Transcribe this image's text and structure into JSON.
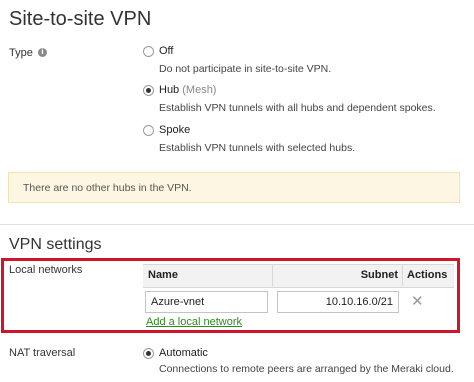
{
  "page_title": "Site-to-site VPN",
  "type": {
    "label": "Type",
    "info_icon": "i",
    "options": [
      {
        "label": "Off",
        "sublabel": "",
        "description": "Do not participate in site-to-site VPN.",
        "checked": false
      },
      {
        "label": "Hub",
        "sublabel": "(Mesh)",
        "description": "Establish VPN tunnels with all hubs and dependent spokes.",
        "checked": true
      },
      {
        "label": "Spoke",
        "sublabel": "",
        "description": "Establish VPN tunnels with selected hubs.",
        "checked": false
      }
    ]
  },
  "notice": "There are no other hubs in the VPN.",
  "vpn_settings": {
    "title": "VPN settings",
    "local_networks_label": "Local networks",
    "columns": {
      "name": "Name",
      "subnet": "Subnet",
      "actions": "Actions"
    },
    "rows": [
      {
        "name": "Azure-vnet",
        "subnet": "10.10.16.0/21"
      }
    ],
    "remove_glyph": "✕",
    "add_link": "Add a local network"
  },
  "nat_traversal": {
    "label": "NAT traversal",
    "option_label": "Automatic",
    "option_checked": true,
    "description": "Connections to remote peers are arranged by the Meraki cloud."
  },
  "colors": {
    "highlight": "#d0142c",
    "link": "#2e8b1f",
    "notice_bg": "#fcf6e3"
  }
}
